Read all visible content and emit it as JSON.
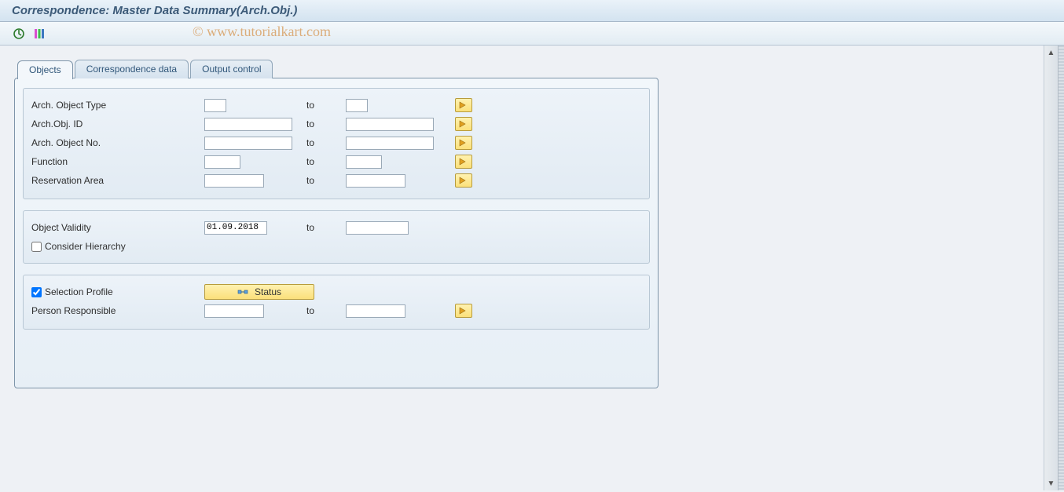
{
  "title": "Correspondence: Master Data Summary(Arch.Obj.)",
  "watermark": "© www.tutorialkart.com",
  "tabs": [
    {
      "label": "Objects"
    },
    {
      "label": "Correspondence data"
    },
    {
      "label": "Output control"
    }
  ],
  "group1": {
    "rows": [
      {
        "label": "Arch. Object Type",
        "from": "",
        "to_label": "to",
        "to": ""
      },
      {
        "label": "Arch.Obj. ID",
        "from": "",
        "to_label": "to",
        "to": ""
      },
      {
        "label": "Arch. Object No.",
        "from": "",
        "to_label": "to",
        "to": ""
      },
      {
        "label": "Function",
        "from": "",
        "to_label": "to",
        "to": ""
      },
      {
        "label": "Reservation Area",
        "from": "",
        "to_label": "to",
        "to": ""
      }
    ]
  },
  "group2": {
    "validity_label": "Object Validity",
    "validity_from": "01.09.2018",
    "validity_to_label": "to",
    "validity_to": "",
    "consider_label": "Consider Hierarchy",
    "consider_checked": false
  },
  "group3": {
    "selprof_label": "Selection Profile",
    "selprof_checked": true,
    "status_button": "Status",
    "person_label": "Person Responsible",
    "person_from": "",
    "person_to_label": "to",
    "person_to": ""
  }
}
